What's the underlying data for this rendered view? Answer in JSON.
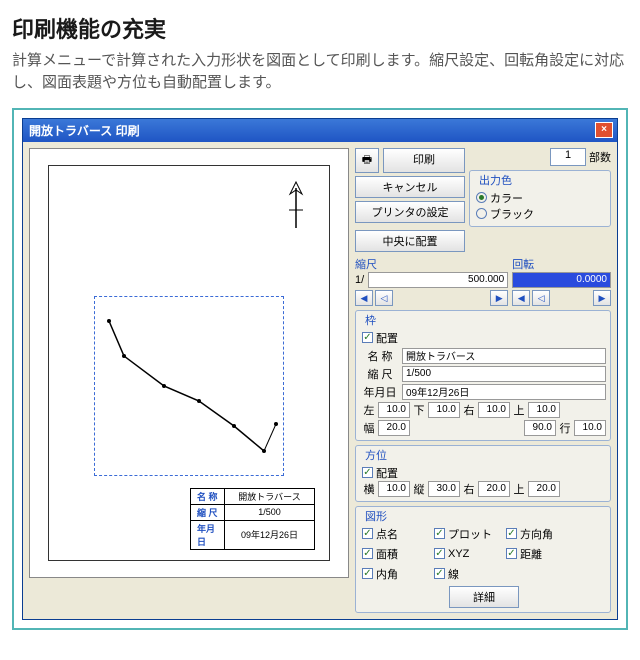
{
  "page": {
    "heading": "印刷機能の充実",
    "description": "計算メニューで計算された入力形状を図面として印刷します。縮尺設定、回転角設定に対応し、図面表題や方位も自動配置します。"
  },
  "window": {
    "title": "開放トラバース 印刷"
  },
  "actions": {
    "print": "印刷",
    "cancel": "キャンセル",
    "printer_setup": "プリンタの設定",
    "center": "中央に配置",
    "details": "詳細"
  },
  "copies": {
    "value": "1",
    "label": "部数"
  },
  "output_color": {
    "group": "出力色",
    "color": "カラー",
    "black": "ブラック",
    "selected": "color"
  },
  "scale": {
    "group": "縮尺",
    "prefix": "1/",
    "value": "500.000"
  },
  "rotation": {
    "group": "回転",
    "value": "0.0000"
  },
  "frame": {
    "group": "枠",
    "place": "配置",
    "name_label": "名 称",
    "name_value": "開放トラバース",
    "scale_label": "縮 尺",
    "scale_value": "1/500",
    "date_label": "年月日",
    "date_value": "09年12月26日",
    "left_l": "左",
    "left_v": "10.0",
    "bottom_l": "下",
    "bottom_v": "10.0",
    "right_l": "右",
    "right_v": "10.0",
    "top_l": "上",
    "top_v": "10.0",
    "width_l": "幅",
    "width_v": "20.0",
    "height_v": "90.0",
    "row_l": "行",
    "row_v": "10.0"
  },
  "direction": {
    "group": "方位",
    "place": "配置",
    "h_l": "横",
    "h_v": "10.0",
    "v_l": "縦",
    "v_v": "30.0",
    "r_l": "右",
    "r_v": "20.0",
    "t_l": "上",
    "t_v": "20.0"
  },
  "figure": {
    "group": "図形",
    "items": {
      "point_name": "点名",
      "plot": "プロット",
      "dir_angle": "方向角",
      "area": "面積",
      "xyz": "XYZ",
      "distance": "距離",
      "in_angle": "内角",
      "line": "線"
    }
  },
  "cartouche": {
    "name_l": "名 称",
    "name_v": "開放トラバース",
    "scale_l": "縮 尺",
    "scale_v": "1/500",
    "date_l": "年月日",
    "date_v": "09年12月26日"
  }
}
